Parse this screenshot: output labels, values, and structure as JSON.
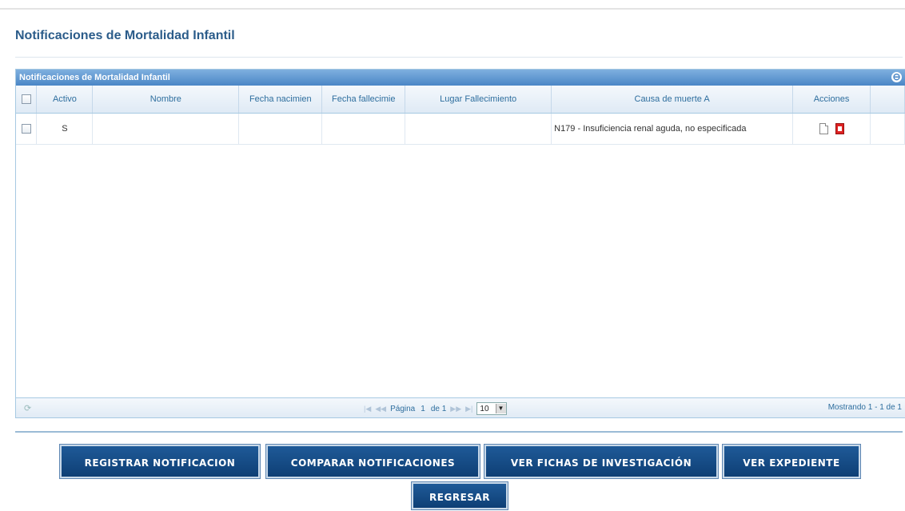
{
  "page": {
    "title": "Notificaciones de Mortalidad Infantil"
  },
  "grid": {
    "caption": "Notificaciones de Mortalidad Infantil",
    "columns": [
      "Activo",
      "Nombre",
      "Fecha nacimien",
      "Fecha fallecimie",
      "Lugar Fallecimiento",
      "Causa de muerte A",
      "Acciones"
    ],
    "rows": [
      {
        "activo": "S",
        "nombre": "",
        "fecha_nacimiento": "",
        "fecha_fallecimiento": "",
        "lugar": "",
        "causa": "N179 - Insuficiencia renal aguda, no especificada"
      }
    ]
  },
  "pager": {
    "page_label": "Página",
    "page_current": "1",
    "of_label": "de 1",
    "page_size": "10",
    "range_text": "Mostrando 1 - 1 de 1"
  },
  "buttons": {
    "registrar": "REGISTRAR NOTIFICACION",
    "comparar": "COMPARAR NOTIFICACIONES",
    "fichas": "VER FICHAS DE INVESTIGACIÓN",
    "expediente": "VER EXPEDIENTE",
    "regresar": "REGRESAR"
  }
}
